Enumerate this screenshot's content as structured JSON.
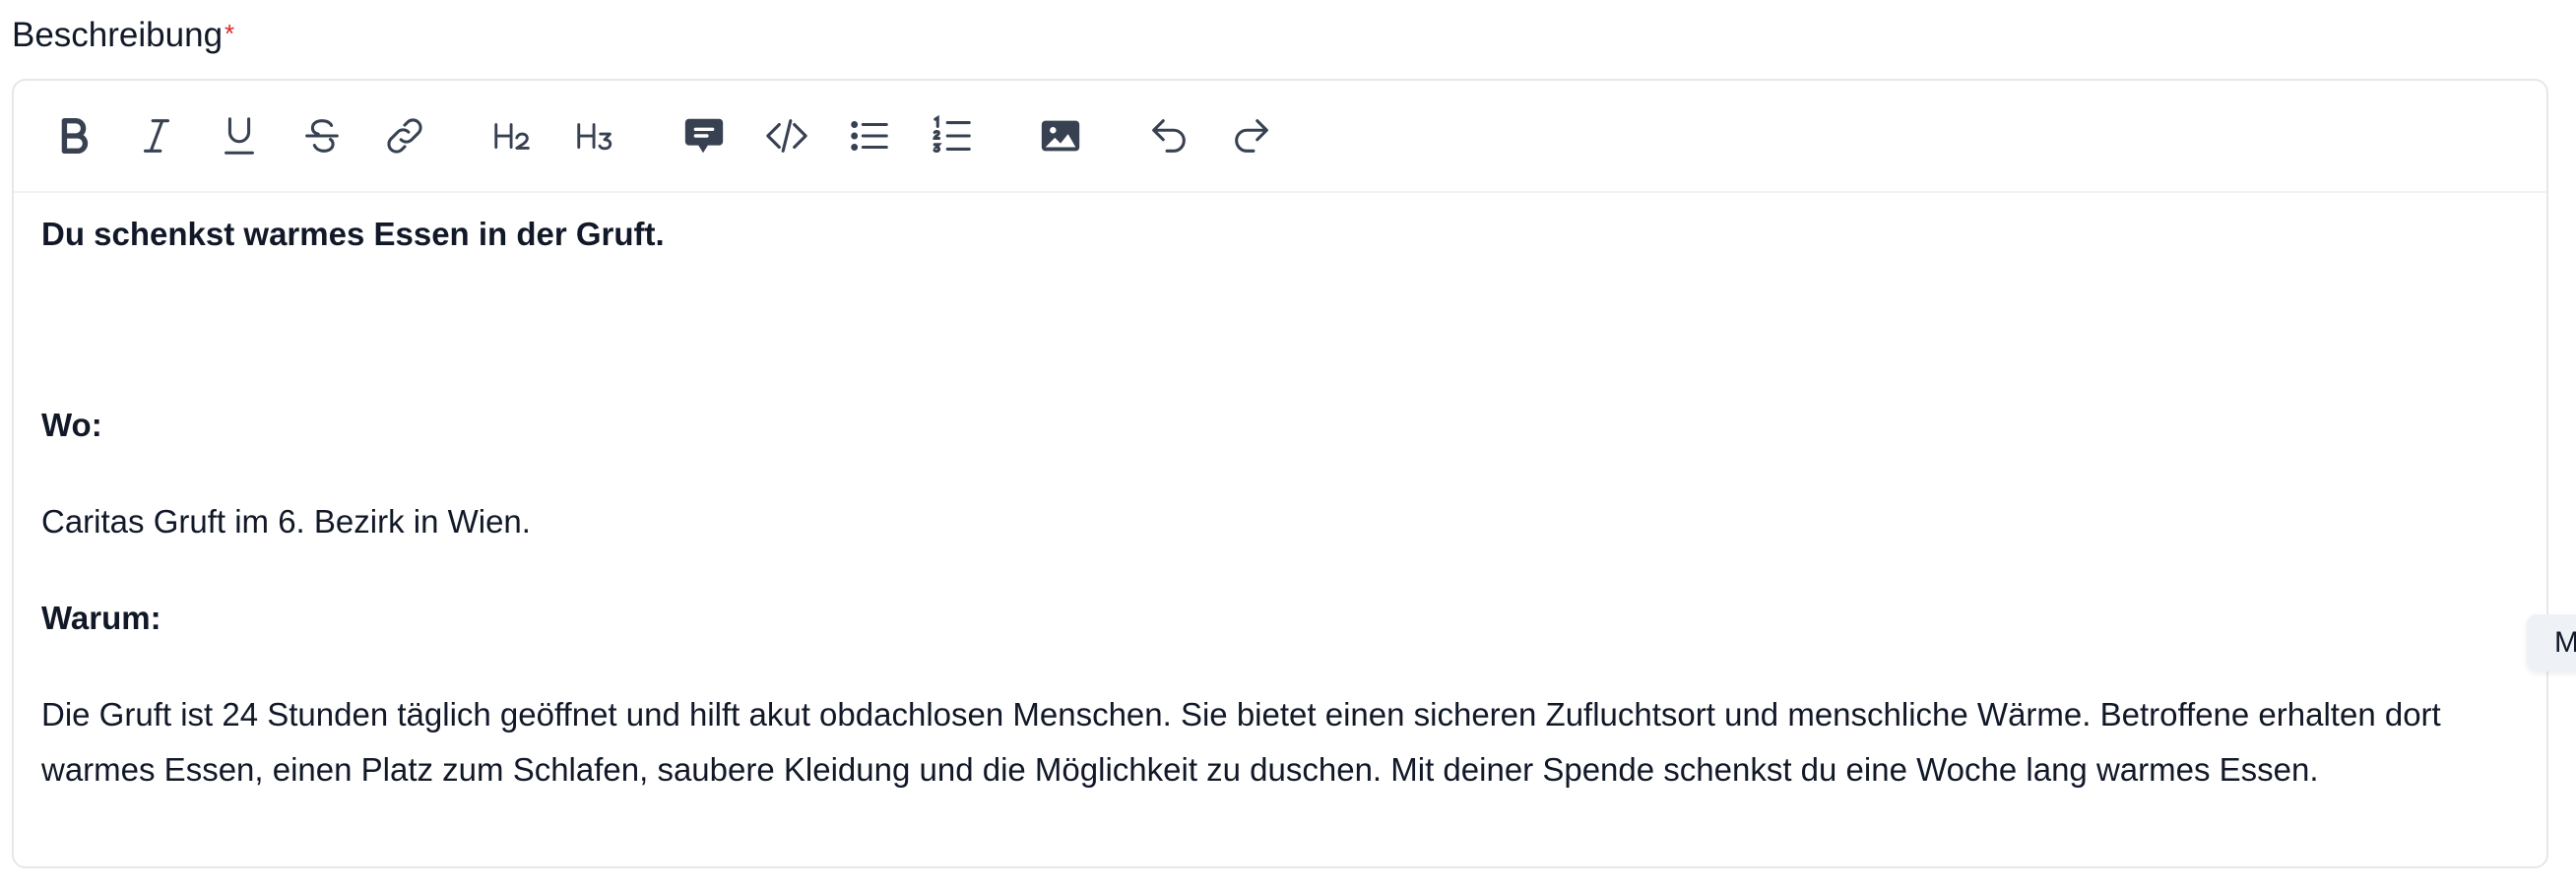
{
  "field": {
    "label": "Beschreibung",
    "required_mark": "*"
  },
  "toolbar": {
    "buttons": [
      {
        "name": "bold-button",
        "icon": "bold-icon"
      },
      {
        "name": "italic-button",
        "icon": "italic-icon"
      },
      {
        "name": "underline-button",
        "icon": "underline-icon"
      },
      {
        "name": "strikethrough-button",
        "icon": "strikethrough-icon"
      },
      {
        "name": "link-button",
        "icon": "link-icon"
      },
      {
        "name": "heading2-button",
        "icon": "h2-icon"
      },
      {
        "name": "heading3-button",
        "icon": "h3-icon"
      },
      {
        "name": "blockquote-button",
        "icon": "speech-bubble-icon"
      },
      {
        "name": "code-button",
        "icon": "code-icon"
      },
      {
        "name": "bullet-list-button",
        "icon": "bullet-list-icon"
      },
      {
        "name": "ordered-list-button",
        "icon": "ordered-list-icon"
      },
      {
        "name": "image-button",
        "icon": "image-icon"
      },
      {
        "name": "undo-button",
        "icon": "undo-icon"
      },
      {
        "name": "redo-button",
        "icon": "redo-icon"
      }
    ]
  },
  "content": {
    "title": "Du schenkst warmes Essen in der Gruft.",
    "where_heading": "Wo:",
    "where_text": "Caritas Gruft im 6. Bezirk in Wien.",
    "why_heading": "Warum:",
    "why_text": "Die Gruft ist 24 Stunden täglich geöffnet und hilft akut obdachlosen Menschen. Sie bietet einen sicheren Zufluchtsort und menschliche Wärme. Betroffene erhalten dort warmes Essen, einen Platz zum Schlafen, saubere Kleidung und die Möglichkeit zu duschen. Mit deiner Spende schenkst du eine Woche lang warmes Essen."
  },
  "side_tab": {
    "label": "M"
  },
  "colors": {
    "required": "#dc2626",
    "border": "#e5e7eb",
    "icon": "#374151",
    "text": "#111827"
  }
}
